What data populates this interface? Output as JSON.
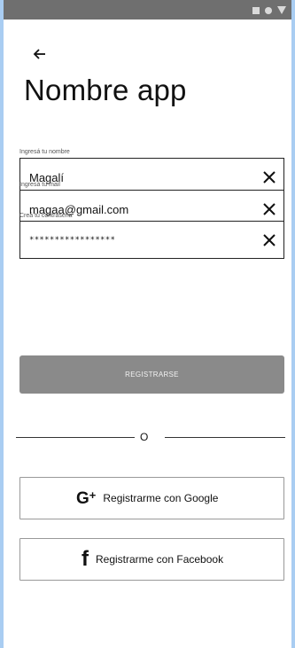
{
  "header": {
    "title": "Nombre app"
  },
  "form": {
    "name": {
      "label": "Ingresá tu nombre",
      "value": "Magalí"
    },
    "email": {
      "label": "Ingresá tu mail",
      "value": "magaa@gmail.com"
    },
    "password": {
      "label": "Creá tu contraseña",
      "value": "*****************"
    }
  },
  "actions": {
    "register_label": "REGISTRARSE",
    "divider_text": "O",
    "google_label": "Registrarme con Google",
    "facebook_label": "Registrarme con Facebook"
  },
  "icons": {
    "back": "arrow-left-icon",
    "clear": "close-icon",
    "google": "google-plus-icon",
    "facebook": "facebook-icon"
  },
  "colors": {
    "background": "#a9cdf2",
    "status_bar": "#6f6f6f",
    "register_button": "#8a8a8a"
  }
}
